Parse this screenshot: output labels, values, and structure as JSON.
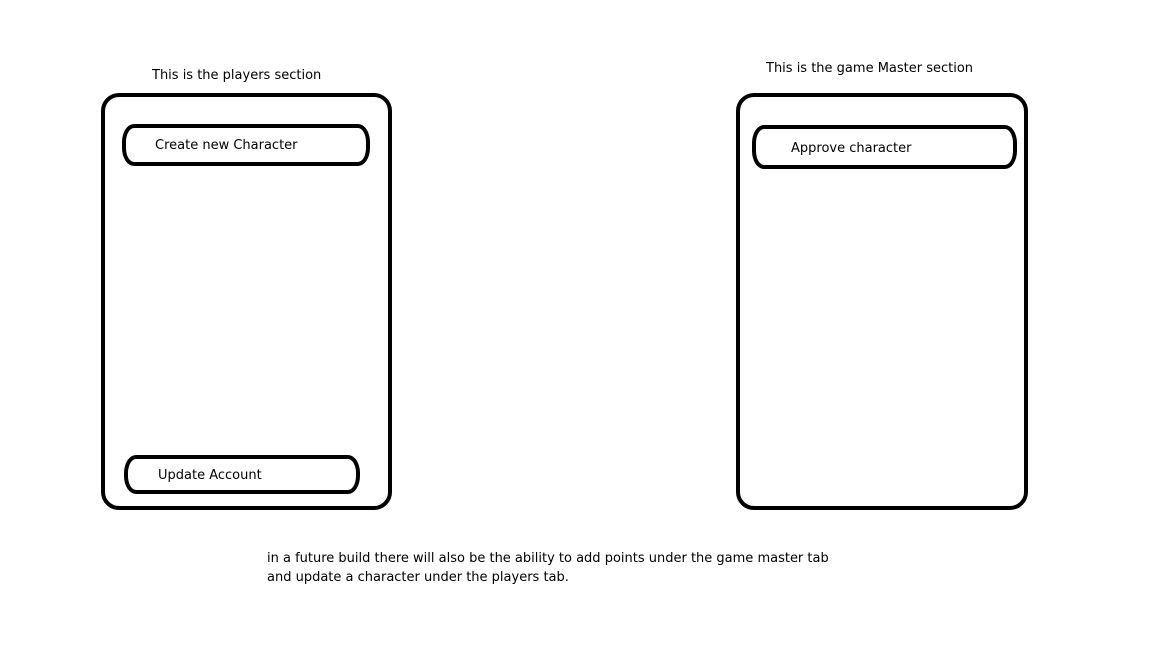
{
  "players_section": {
    "caption": "This is the players section",
    "buttons": {
      "create_character": "Create new Character",
      "update_account": "Update Account"
    }
  },
  "game_master_section": {
    "caption": "This is the game Master section",
    "buttons": {
      "approve_character": "Approve character"
    }
  },
  "footer_note": {
    "line1": "in a future build there will also be the ability to add points under the game master tab",
    "line2": "and update a character under the players tab."
  }
}
